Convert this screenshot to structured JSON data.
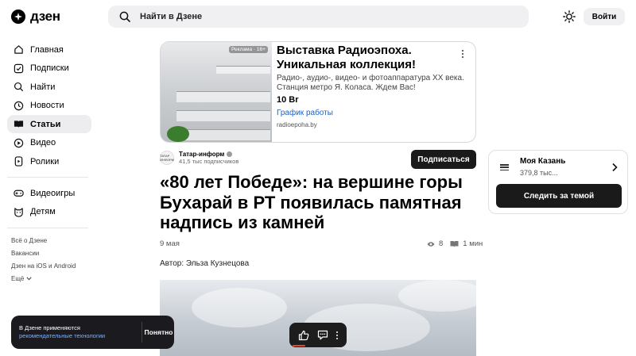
{
  "header": {
    "logo_text": "дзен",
    "search_placeholder": "Найти в Дзене",
    "login_label": "Войти"
  },
  "sidebar": {
    "items": [
      {
        "label": "Главная",
        "icon": "home-icon"
      },
      {
        "label": "Подписки",
        "icon": "subscriptions-icon"
      },
      {
        "label": "Найти",
        "icon": "search-icon"
      },
      {
        "label": "Новости",
        "icon": "news-icon"
      },
      {
        "label": "Статьи",
        "icon": "articles-icon",
        "active": true
      },
      {
        "label": "Видео",
        "icon": "video-icon"
      },
      {
        "label": "Ролики",
        "icon": "shorts-icon"
      }
    ],
    "items2": [
      {
        "label": "Видеоигры",
        "icon": "gamepad-icon"
      },
      {
        "label": "Детям",
        "icon": "kids-icon"
      }
    ],
    "footer_links": [
      "Всё о Дзене",
      "Вакансии",
      "Дзен на iOS и Android",
      "Ещё"
    ]
  },
  "ad": {
    "badge": "Реклама · 16+",
    "title": "Выставка Радиоэпоха. Уникальная коллекция!",
    "description": "Радио-, аудио-, видео- и фотоаппаратура XX века. Станция метро Я. Коласа. Ждем Вас!",
    "price": "10 Br",
    "link": "График работы",
    "domain": "radioepoha.by"
  },
  "channel": {
    "avatar_text": "ТАТАР ИНФОРМ",
    "name": "Татар-информ",
    "subscribers": "41,5 тыс подписчиков",
    "subscribe_label": "Подписаться"
  },
  "article": {
    "title": "«80 лет Победе»: на вершине горы Бухарай в РТ появилась памятная надпись из камней",
    "date": "9 мая",
    "views": "8",
    "read_time": "1 мин",
    "author": "Автор: Эльза Кузнецова"
  },
  "notice": {
    "text": "В Дзене применяются",
    "link": "рекомендательные технологии",
    "button": "Понятно"
  },
  "topic": {
    "title": "Моя Казань",
    "count": "379,8 тыс...",
    "follow_label": "Следить за темой"
  },
  "colors": {
    "accent_dark": "#1a1a1a",
    "link": "#1c61c9",
    "active_bg": "#ededf0"
  }
}
